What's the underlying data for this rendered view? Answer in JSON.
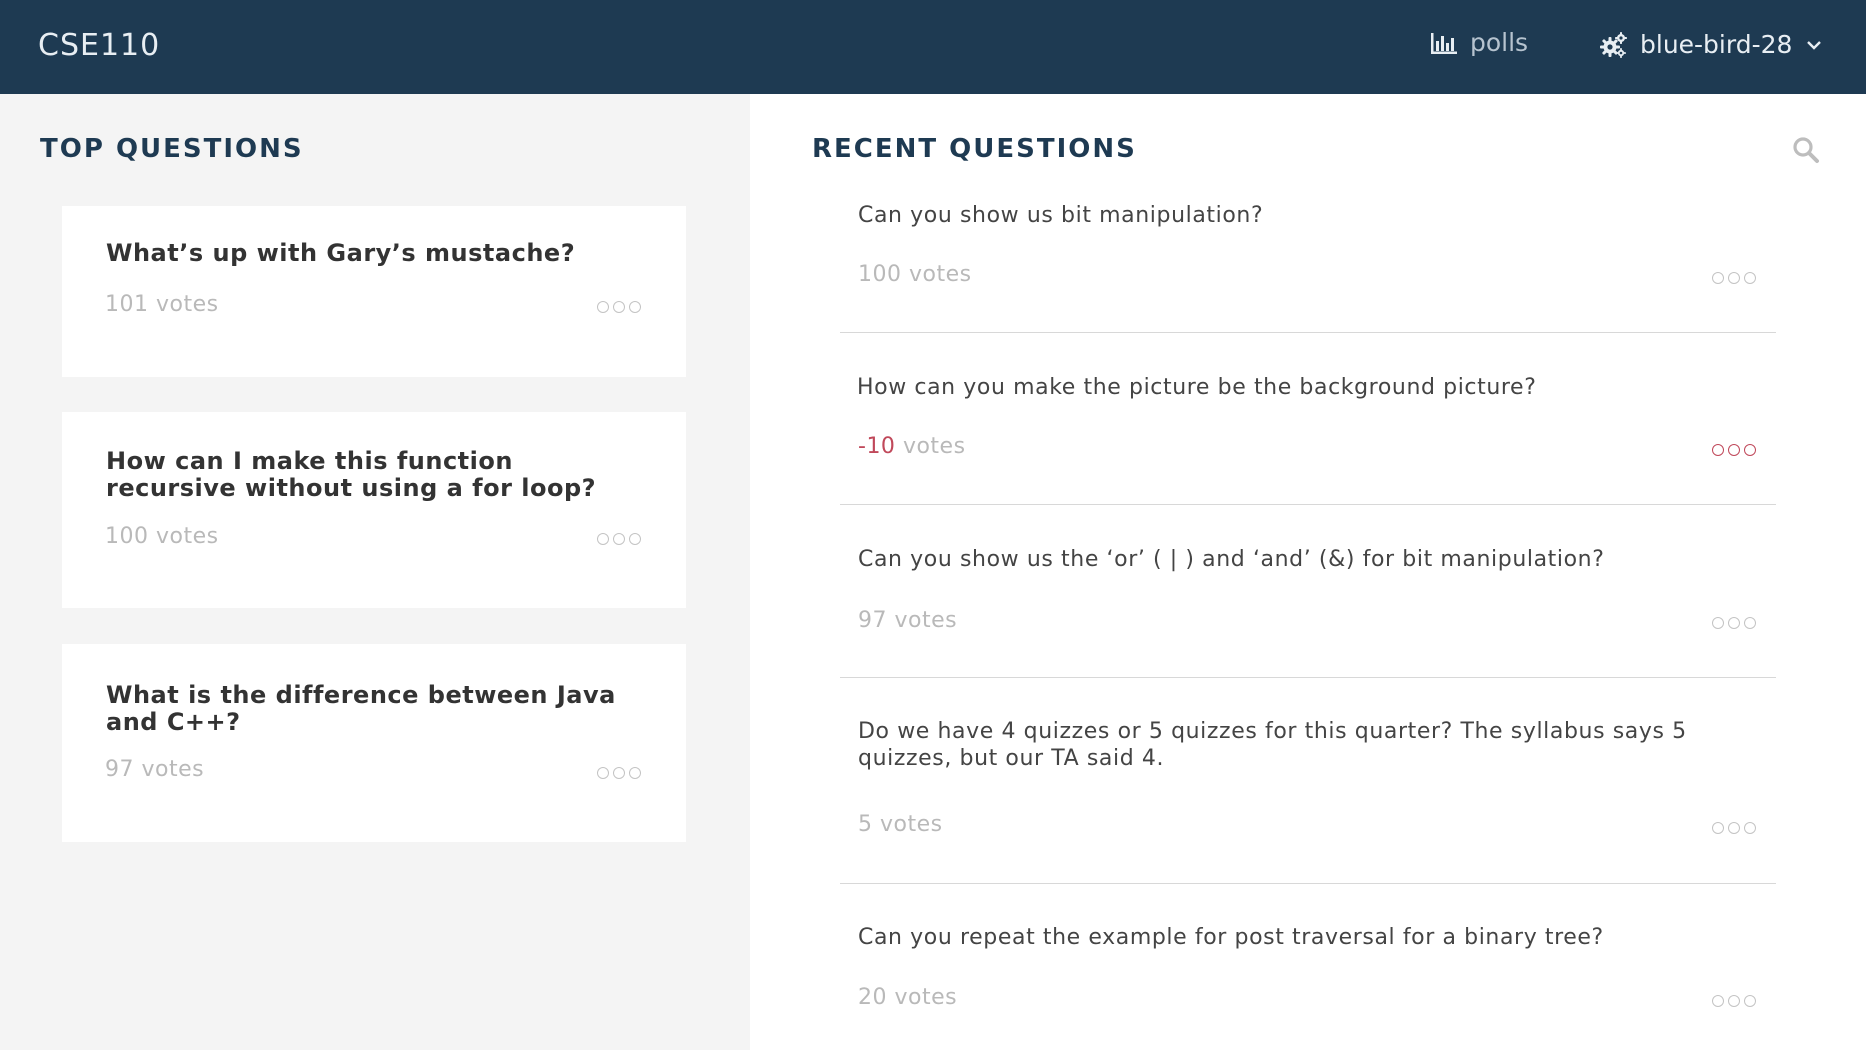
{
  "header": {
    "brand": "CSE110",
    "polls_label": "polls",
    "username": "blue-bird-28"
  },
  "top": {
    "title": "TOP QUESTIONS",
    "questions": [
      {
        "text": "What’s up with Gary’s mustache?",
        "votes": "101",
        "votes_label": "votes"
      },
      {
        "text": "How can I make this function recursive without using a for loop?",
        "votes": "100",
        "votes_label": "votes"
      },
      {
        "text": "What is the difference between Java and C++?",
        "votes": "97",
        "votes_label": "votes"
      }
    ]
  },
  "recent": {
    "title": "RECENT QUESTIONS",
    "questions": [
      {
        "text": "Can you show us bit manipulation?",
        "votes": "100",
        "votes_label": "votes"
      },
      {
        "text": "How can you make the picture be the background picture?",
        "votes": "-10",
        "votes_label": "votes"
      },
      {
        "text": "Can you show us the ‘or’ ( | ) and ‘and’ (&) for bit manipulation?",
        "votes": "97",
        "votes_label": "votes"
      },
      {
        "text": "Do we have 4 quizzes or 5 quizzes for this quarter?  The syllabus says 5 quizzes, but our TA said 4.",
        "votes": "5",
        "votes_label": "votes"
      },
      {
        "text": "Can you repeat the example for post traversal for a binary tree?",
        "votes": "20",
        "votes_label": "votes"
      }
    ]
  },
  "icons": {
    "polls": "bar-chart-icon",
    "user": "gears-icon",
    "menu": "chevron-down-icon",
    "search": "search-icon",
    "more": "more-dots-icon"
  },
  "colors": {
    "header_bg": "#1e3a52",
    "accent_negative": "#c0485a",
    "left_bg": "#f4f4f4"
  }
}
